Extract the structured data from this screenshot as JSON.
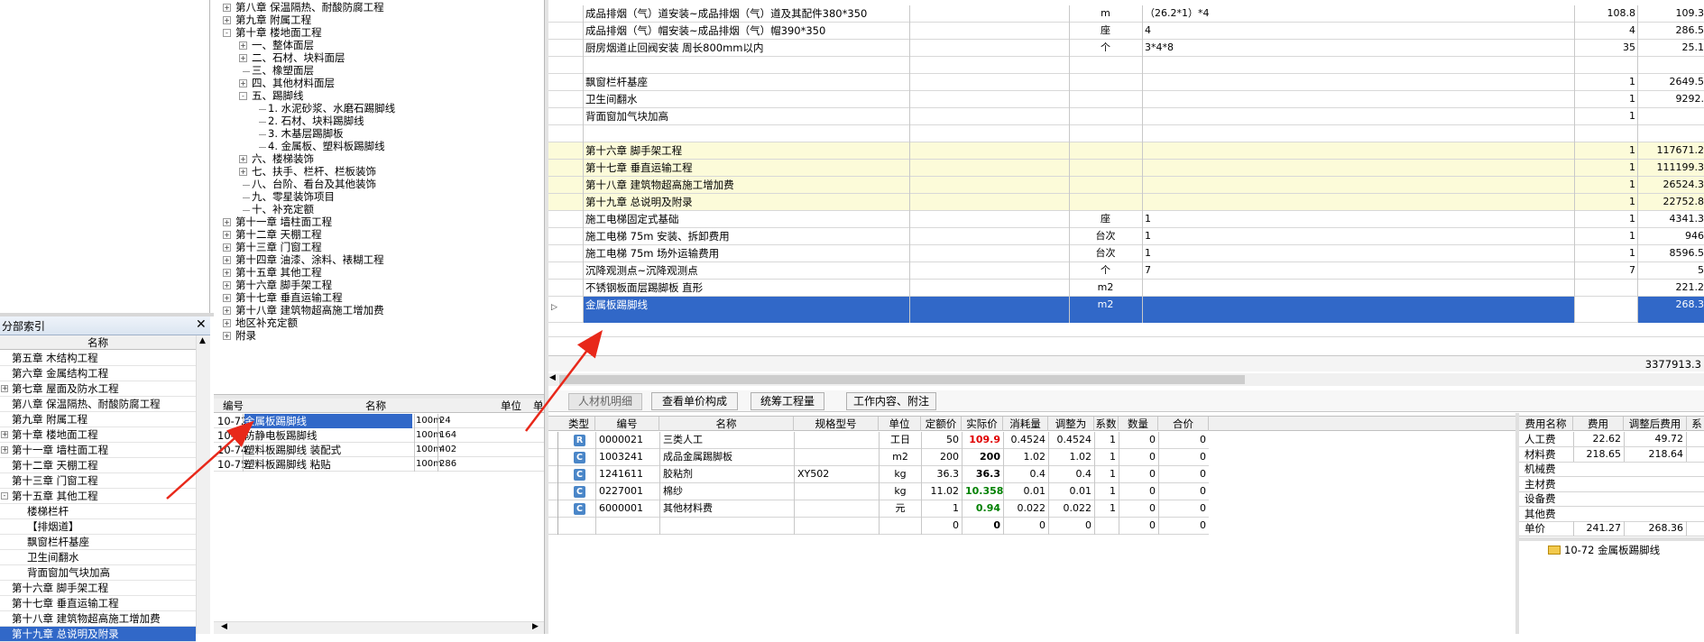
{
  "left_index": {
    "title": "分部索引",
    "col_header": "名称",
    "items": [
      {
        "label": "第五章 木结构工程",
        "indent": 0
      },
      {
        "label": "第六章 金属结构工程",
        "indent": 0
      },
      {
        "label": "第七章 屋面及防水工程",
        "indent": 0
      },
      {
        "label": "第八章 保温隔热、耐酸防腐工程",
        "indent": 0
      },
      {
        "label": "第九章 附属工程",
        "indent": 0
      },
      {
        "label": "第十章 楼地面工程",
        "indent": 0
      },
      {
        "label": "第十一章 墙柱面工程",
        "indent": 0
      },
      {
        "label": "第十二章 天棚工程",
        "indent": 0
      },
      {
        "label": "第十三章 门窗工程",
        "indent": 0
      },
      {
        "label": "第十五章 其他工程",
        "indent": 0
      },
      {
        "label": "楼梯栏杆",
        "indent": 1
      },
      {
        "label": "【排烟道】",
        "indent": 1
      },
      {
        "label": "飘窗栏杆基座",
        "indent": 1
      },
      {
        "label": "卫生间翻水",
        "indent": 1
      },
      {
        "label": "背面窗加气块加高",
        "indent": 1
      },
      {
        "label": "第十六章 脚手架工程",
        "indent": 0
      },
      {
        "label": "第十七章 垂直运输工程",
        "indent": 0
      },
      {
        "label": "第十八章 建筑物超高施工增加费",
        "indent": 0
      },
      {
        "label": "第十九章 总说明及附录",
        "indent": 0
      }
    ]
  },
  "tree": {
    "items": [
      {
        "label": "第八章 保温隔热、耐酸防腐工程",
        "level": 0,
        "exp": "+"
      },
      {
        "label": "第九章 附属工程",
        "level": 0,
        "exp": "+"
      },
      {
        "label": "第十章 楼地面工程",
        "level": 0,
        "exp": "-"
      },
      {
        "label": "一、整体面层",
        "level": 1,
        "exp": "+"
      },
      {
        "label": "二、石材、块料面层",
        "level": 1,
        "exp": "+"
      },
      {
        "label": "三、橡塑面层",
        "level": 1,
        "exp": ""
      },
      {
        "label": "四、其他材料面层",
        "level": 1,
        "exp": "+"
      },
      {
        "label": "五、踢脚线",
        "level": 1,
        "exp": "-"
      },
      {
        "label": "1. 水泥砂浆、水磨石踢脚线",
        "level": 2,
        "exp": ""
      },
      {
        "label": "2. 石材、块料踢脚线",
        "level": 2,
        "exp": ""
      },
      {
        "label": "3. 木基层踢脚板",
        "level": 2,
        "exp": ""
      },
      {
        "label": "4. 金属板、塑料板踢脚线",
        "level": 2,
        "exp": ""
      },
      {
        "label": "六、楼梯装饰",
        "level": 1,
        "exp": "+"
      },
      {
        "label": "七、扶手、栏杆、栏板装饰",
        "level": 1,
        "exp": "+"
      },
      {
        "label": "八、台阶、看台及其他装饰",
        "level": 1,
        "exp": ""
      },
      {
        "label": "九、零星装饰项目",
        "level": 1,
        "exp": ""
      },
      {
        "label": "十、补充定额",
        "level": 1,
        "exp": ""
      },
      {
        "label": "第十一章 墙柱面工程",
        "level": 0,
        "exp": "+"
      },
      {
        "label": "第十二章 天棚工程",
        "level": 0,
        "exp": "+"
      },
      {
        "label": "第十三章 门窗工程",
        "level": 0,
        "exp": "+"
      },
      {
        "label": "第十四章 油漆、涂料、裱糊工程",
        "level": 0,
        "exp": "+"
      },
      {
        "label": "第十五章 其他工程",
        "level": 0,
        "exp": "+"
      },
      {
        "label": "第十六章 脚手架工程",
        "level": 0,
        "exp": "+"
      },
      {
        "label": "第十七章 垂直运输工程",
        "level": 0,
        "exp": "+"
      },
      {
        "label": "第十八章 建筑物超高施工增加费",
        "level": 0,
        "exp": "+"
      },
      {
        "label": "地区补充定额",
        "level": 0,
        "exp": "+"
      },
      {
        "label": "附录",
        "level": 0,
        "exp": "+"
      }
    ]
  },
  "quota_list": {
    "headers": {
      "code": "编号",
      "name": "名称",
      "unit": "单位",
      "price": "单"
    },
    "rows": [
      {
        "code": "10-72",
        "name": "金属板踢脚线",
        "unit": "100m",
        "price": "24"
      },
      {
        "code": "10-73",
        "name": "防静电板踢脚线",
        "unit": "100m",
        "price": "164"
      },
      {
        "code": "10-74",
        "name": "塑料板踢脚线 装配式",
        "unit": "100m",
        "price": "402"
      },
      {
        "code": "10-75",
        "name": "塑料板踢脚线 粘贴",
        "unit": "100m",
        "price": "286"
      }
    ]
  },
  "main_grid": {
    "rows": [
      {
        "name": "成品排烟（气）道安装~成品排烟（气）道及其配件380*350",
        "unit": "m",
        "expr": "（26.2*1）*4",
        "qty": "108.8",
        "price": "109.3",
        "style": "normal"
      },
      {
        "name": "成品排烟（气）帽安装~成品排烟（气）帽390*350",
        "unit": "座",
        "expr": "4",
        "qty": "4",
        "price": "286.5",
        "style": "normal"
      },
      {
        "name": "厨房烟道止回阀安装  周长800mm以内",
        "unit": "个",
        "expr": "3*4*8",
        "qty": "35",
        "price": "25.1",
        "style": "normal"
      },
      {
        "name": "",
        "unit": "",
        "expr": "",
        "qty": "",
        "price": "",
        "style": "normal"
      },
      {
        "name": "飘窗栏杆基座",
        "unit": "",
        "expr": "",
        "qty": "1",
        "price": "2649.5",
        "style": "normal"
      },
      {
        "name": "卫生间翻水",
        "unit": "",
        "expr": "",
        "qty": "1",
        "price": "9292.",
        "style": "normal"
      },
      {
        "name": "背面窗加气块加高",
        "unit": "",
        "expr": "",
        "qty": "1",
        "price": "",
        "style": "normal"
      },
      {
        "name": "",
        "unit": "",
        "expr": "",
        "qty": "",
        "price": "",
        "style": "normal"
      },
      {
        "name": "第十六章 脚手架工程",
        "unit": "",
        "expr": "",
        "qty": "1",
        "price": "117671.2",
        "style": "chapter"
      },
      {
        "name": "第十七章 垂直运输工程",
        "unit": "",
        "expr": "",
        "qty": "1",
        "price": "111199.3",
        "style": "chapter"
      },
      {
        "name": "第十八章 建筑物超高施工增加费",
        "unit": "",
        "expr": "",
        "qty": "1",
        "price": "26524.3",
        "style": "chapter"
      },
      {
        "name": "第十九章 总说明及附录",
        "unit": "",
        "expr": "",
        "qty": "1",
        "price": "22752.8",
        "style": "chapter"
      },
      {
        "name": "施工电梯固定式基础",
        "unit": "座",
        "expr": "1",
        "qty": "1",
        "price": "4341.3",
        "style": "normal"
      },
      {
        "name": "施工电梯 75m 安装、拆卸费用",
        "unit": "台次",
        "expr": "1",
        "qty": "1",
        "price": "946",
        "style": "normal"
      },
      {
        "name": "施工电梯 75m 场外运输费用",
        "unit": "台次",
        "expr": "1",
        "qty": "1",
        "price": "8596.5",
        "style": "normal"
      },
      {
        "name": "沉降观测点~沉降观测点",
        "unit": "个",
        "expr": "7",
        "qty": "7",
        "price": "5",
        "style": "normal"
      },
      {
        "name": "不锈钢板面层踢脚板 直形",
        "unit": "m2",
        "expr": "",
        "qty": "",
        "price": "221.2",
        "style": "normal"
      },
      {
        "name": "金属板踢脚线",
        "unit": "m2",
        "expr": "",
        "qty": "",
        "price": "268.3",
        "style": "selected"
      }
    ],
    "total": "3377913.3"
  },
  "detail_tabs": [
    {
      "label": "人材机明细"
    },
    {
      "label": "查看单价构成"
    },
    {
      "label": "统筹工程量"
    },
    {
      "label": "工作内容、附注"
    }
  ],
  "materials": {
    "headers": [
      "类型",
      "编号",
      "名称",
      "规格型号",
      "单位",
      "定额价",
      "实际价",
      "消耗量",
      "调整为",
      "系数",
      "数量",
      "合价"
    ],
    "rows": [
      {
        "type": "R",
        "code": "0000021",
        "name": "三类人工",
        "spec": "",
        "unit": "工日",
        "base": "50",
        "actual": "109.9",
        "actual_color": "#e00000",
        "cons": "0.4524",
        "adj": "0.4524",
        "coef": "1",
        "qty": "0",
        "total": "0"
      },
      {
        "type": "C",
        "code": "1003241",
        "name": "成品金属踢脚板",
        "spec": "",
        "unit": "m2",
        "base": "200",
        "actual": "200",
        "actual_color": "#000000",
        "cons": "1.02",
        "adj": "1.02",
        "coef": "1",
        "qty": "0",
        "total": "0"
      },
      {
        "type": "C",
        "code": "1241611",
        "name": "胶粘剂",
        "spec": "XY502",
        "unit": "kg",
        "base": "36.3",
        "actual": "36.3",
        "actual_color": "#000000",
        "cons": "0.4",
        "adj": "0.4",
        "coef": "1",
        "qty": "0",
        "total": "0"
      },
      {
        "type": "C",
        "code": "0227001",
        "name": "棉纱",
        "spec": "",
        "unit": "kg",
        "base": "11.02",
        "actual": "10.3588",
        "actual_color": "#008000",
        "cons": "0.01",
        "adj": "0.01",
        "coef": "1",
        "qty": "0",
        "total": "0"
      },
      {
        "type": "C",
        "code": "6000001",
        "name": "其他材料费",
        "spec": "",
        "unit": "元",
        "base": "1",
        "actual": "0.94",
        "actual_color": "#008000",
        "cons": "0.022",
        "adj": "0.022",
        "coef": "1",
        "qty": "0",
        "total": "0"
      },
      {
        "type": "",
        "code": "",
        "name": "",
        "spec": "",
        "unit": "",
        "base": "0",
        "actual": "0",
        "actual_color": "#000000",
        "cons": "0",
        "adj": "0",
        "coef": "",
        "qty": "0",
        "total": "0"
      }
    ]
  },
  "fees": {
    "headers": [
      "费用名称",
      "费用",
      "调整后费用",
      "系"
    ],
    "rows": [
      {
        "name": "人工费",
        "fee": "22.62",
        "adj": "49.72"
      },
      {
        "name": "材料费",
        "fee": "218.65",
        "adj": "218.64"
      },
      {
        "name": "机械费",
        "fee": "",
        "adj": ""
      },
      {
        "name": "主材费",
        "fee": "",
        "adj": ""
      },
      {
        "name": "设备费",
        "fee": "",
        "adj": ""
      },
      {
        "name": "其他费",
        "fee": "",
        "adj": ""
      },
      {
        "name": "单价",
        "fee": "241.27",
        "adj": "268.36"
      }
    ],
    "node": "10-72 金属板踢脚线"
  },
  "colors": {
    "selected_bg": "#3168c8",
    "chapter_bg": "#fcfbd9",
    "arrow": "#e8281a"
  }
}
